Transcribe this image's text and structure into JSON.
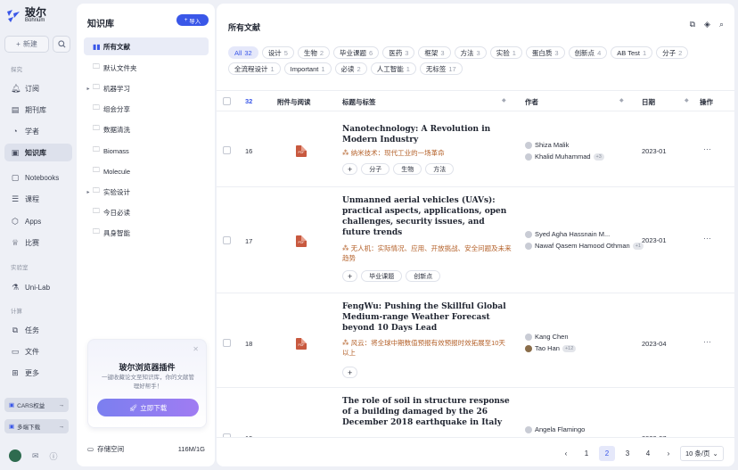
{
  "brand": {
    "name_cn": "玻尔",
    "name_en": "Bohrium"
  },
  "nav": {
    "new_label": "新建",
    "sections": {
      "explore": "探究",
      "lab": "实验室",
      "compute": "计算"
    },
    "items": [
      {
        "label": "订阅",
        "icon": "bell-icon"
      },
      {
        "label": "期刊库",
        "icon": "journal-icon"
      },
      {
        "label": "学者",
        "icon": "scholar-icon"
      },
      {
        "label": "知识库",
        "icon": "knowledge-icon"
      },
      {
        "label": "Notebooks",
        "icon": "notebook-icon"
      },
      {
        "label": "课程",
        "icon": "course-icon"
      },
      {
        "label": "Apps",
        "icon": "apps-icon"
      },
      {
        "label": "比赛",
        "icon": "trophy-icon"
      },
      {
        "label": "Uni-Lab",
        "icon": "lab-icon"
      },
      {
        "label": "任务",
        "icon": "task-icon"
      },
      {
        "label": "文件",
        "icon": "file-icon"
      },
      {
        "label": "更多",
        "icon": "more-icon"
      }
    ],
    "promo_cars": "CARS权益",
    "promo_multi": "多端下载"
  },
  "library": {
    "title": "知识库",
    "import_label": "导入",
    "tree": [
      {
        "label": "所有文献",
        "expand": ""
      },
      {
        "label": "默认文件夹",
        "expand": ""
      },
      {
        "label": "机器学习",
        "expand": "▸"
      },
      {
        "label": "组会分享",
        "expand": ""
      },
      {
        "label": "数据清洗",
        "expand": ""
      },
      {
        "label": "Biomass",
        "expand": ""
      },
      {
        "label": "Molecule",
        "expand": ""
      },
      {
        "label": "实验设计",
        "expand": "▸"
      },
      {
        "label": "今日必读",
        "expand": ""
      },
      {
        "label": "具身智能",
        "expand": ""
      }
    ],
    "promo": {
      "title": "玻尔浏览器插件",
      "desc": "一键收藏论文至知识库，你的文献管理好帮手！",
      "button": "立即下载"
    },
    "storage_label": "存储空间",
    "storage_value": "116M/1G"
  },
  "main": {
    "title": "所有文献",
    "tags": [
      {
        "label": "All",
        "count": "32"
      },
      {
        "label": "设计",
        "count": "5"
      },
      {
        "label": "生物",
        "count": "2"
      },
      {
        "label": "毕业课题",
        "count": "6"
      },
      {
        "label": "医药",
        "count": "3"
      },
      {
        "label": "框架",
        "count": "3"
      },
      {
        "label": "方法",
        "count": "3"
      },
      {
        "label": "实验",
        "count": "1"
      },
      {
        "label": "蛋白质",
        "count": "3"
      },
      {
        "label": "创新点",
        "count": "4"
      },
      {
        "label": "AB Test",
        "count": "1"
      },
      {
        "label": "分子",
        "count": "2"
      },
      {
        "label": "全流程设计",
        "count": "1"
      },
      {
        "label": "Important",
        "count": "1"
      },
      {
        "label": "必读",
        "count": "2"
      },
      {
        "label": "人工智能",
        "count": "1"
      },
      {
        "label": "无标签",
        "count": "17"
      }
    ],
    "columns": {
      "count": "32",
      "attach": "附件与阅读",
      "title": "标题与标签",
      "author": "作者",
      "date": "日期",
      "ops": "操作"
    },
    "rows": [
      {
        "num": "16",
        "title": "Nanotechnology: A Revolution in Modern Industry",
        "trans": "纳米技术：现代工业的一场革命",
        "chips": [
          "分子",
          "生物",
          "方法"
        ],
        "authors": [
          "Shiza Malik",
          "Khalid Muhammad"
        ],
        "more": "+3",
        "date": "2023-01"
      },
      {
        "num": "17",
        "title": "Unmanned aerial vehicles (UAVs): practical aspects, applications, open challenges, security issues, and future trends",
        "trans": "无人机：实际情况、应用、开放挑战、安全问题及未来趋势",
        "chips": [
          "毕业课题",
          "创新点"
        ],
        "authors": [
          "Syed Agha Hassnain M...",
          "Nawaf Qasem Hamood Othman"
        ],
        "more": "+1",
        "date": "2023-01"
      },
      {
        "num": "18",
        "title": "FengWu: Pushing the Skillful Global Medium-range Weather Forecast beyond 10 Days Lead",
        "trans": "风云：将全球中期数值预报有效预报时效拓展至10天以上",
        "chips": [],
        "authors": [
          "Kang Chen",
          "Tao Han"
        ],
        "more": "+12",
        "date": "2023-04"
      },
      {
        "num": "19",
        "title": "The role of soil in structure response of a building damaged by the 26 December 2018 earthquake in Italy",
        "trans": "",
        "chips": [],
        "authors": [
          "Angela Flamingo"
        ],
        "more": "",
        "date": "2022-07"
      }
    ],
    "pager": {
      "pages": [
        "1",
        "2",
        "3",
        "4"
      ],
      "current": "2",
      "size": "10 条/页"
    }
  }
}
